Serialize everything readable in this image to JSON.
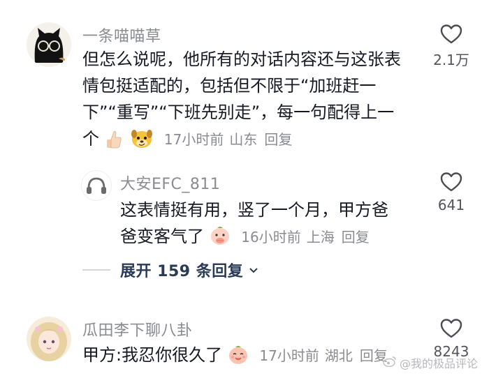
{
  "comments": [
    {
      "username": "一条喵喵草",
      "avatar_icon": "black-cat-with-glasses-avatar",
      "lines": [
        "但怎么说呢，他所有的对话内容还与这张表",
        "情包挺适配的，包括但不限于“加班赶一",
        "下”“重写”“下班先别走”，每一句配得上一",
        "个"
      ],
      "emojis": [
        "thumbs-up-emoji",
        "smirking-dog-emoji"
      ],
      "time": "17小时前",
      "location": "山东",
      "reply_label": "回复",
      "like_count": "2.1万"
    },
    {
      "username": "大安EFC_811",
      "avatar_icon": "headphones-avatar",
      "lines": [
        "这表情挺有用，竖了一个月，甲方爸",
        "爸变客气了"
      ],
      "emojis": [
        "covering-mouth-blob-emoji"
      ],
      "time": "16小时前",
      "location": "上海",
      "reply_label": "回复",
      "like_count": "641"
    },
    {
      "username": "瓜田李下聊八卦",
      "avatar_icon": "anime-girl-avatar",
      "lines": [
        "甲方:我忍你很久了"
      ],
      "emojis": [
        "smiling-peach-emoji"
      ],
      "time": "17小时前",
      "location": "湖北",
      "reply_label": "回复",
      "like_count": "8243"
    }
  ],
  "expand_replies_label": "展开 159 条回复",
  "watermark": "@我的极品评论",
  "colors": {
    "text": "#161823",
    "meta": "#8a8b91",
    "expand": "#2a3b58",
    "heart_outline": "#4a4b52"
  }
}
